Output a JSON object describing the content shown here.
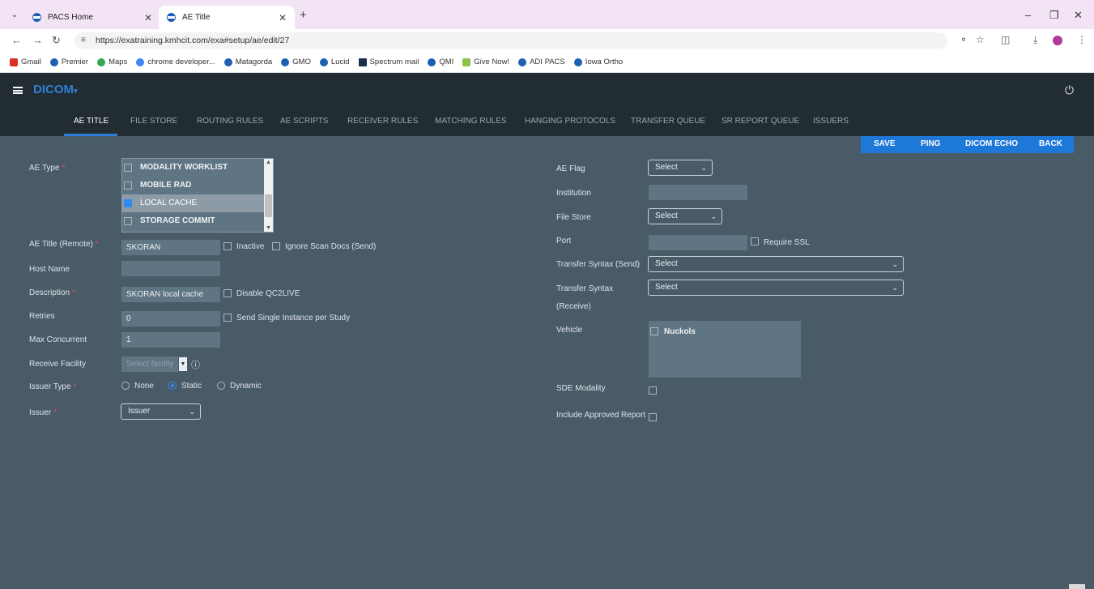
{
  "browser": {
    "tabs": [
      {
        "title": "PACS Home"
      },
      {
        "title": "AE Title"
      }
    ],
    "url": "https://exatraining.kmhcit.com/exa#setup/ae/edit/27",
    "bookmarks": [
      "Gmail",
      "Premier",
      "Maps",
      "chrome developer...",
      "Matagorda",
      "GMO",
      "Lucid",
      "Spectrum mail",
      "QMI",
      "Give Now!",
      "ADI PACS",
      "Iowa Ortho"
    ]
  },
  "app": {
    "title": "DICOM",
    "tabs": [
      "AE TITLE",
      "FILE STORE",
      "ROUTING RULES",
      "AE SCRIPTS",
      "RECEIVER RULES",
      "MATCHING RULES",
      "HANGING PROTOCOLS",
      "TRANSFER QUEUE",
      "SR REPORT QUEUE",
      "ISSUERS"
    ],
    "active_tab": "AE TITLE"
  },
  "actions": {
    "save": "SAVE",
    "ping": "PING",
    "dicom_echo": "DICOM ECHO",
    "back": "BACK"
  },
  "form_left": {
    "ae_type": {
      "label": "AE Type",
      "options": [
        "MODALITY WORKLIST",
        "MOBILE RAD",
        "LOCAL CACHE",
        "STORAGE COMMIT"
      ],
      "selected": "LOCAL CACHE"
    },
    "ae_title": {
      "label": "AE Title (Remote)",
      "value": "SKORAN"
    },
    "inactive": {
      "label": "Inactive",
      "checked": false
    },
    "ignore_scan_docs": {
      "label": "Ignore Scan Docs (Send)",
      "checked": false
    },
    "host_name": {
      "label": "Host Name",
      "value": ""
    },
    "description": {
      "label": "Description",
      "value": "SKORAN local cache"
    },
    "disable_qc2live": {
      "label": "Disable QC2LIVE",
      "checked": false
    },
    "retries": {
      "label": "Retries",
      "value": "0"
    },
    "send_single_instance": {
      "label": "Send Single Instance per Study",
      "checked": false
    },
    "max_concurrent": {
      "label": "Max Concurrent",
      "value": "1"
    },
    "receive_facility": {
      "label": "Receive Facility",
      "placeholder": "Select facility"
    },
    "issuer_type": {
      "label": "Issuer Type",
      "options": [
        "None",
        "Static",
        "Dynamic"
      ],
      "selected": "Static"
    },
    "issuer": {
      "label": "Issuer",
      "value": "Issuer"
    }
  },
  "form_right": {
    "ae_flag": {
      "label": "AE Flag",
      "value": "Select"
    },
    "institution": {
      "label": "Institution",
      "value": ""
    },
    "file_store": {
      "label": "File Store",
      "value": "Select"
    },
    "port": {
      "label": "Port",
      "value": ""
    },
    "require_ssl": {
      "label": "Require SSL",
      "checked": false
    },
    "transfer_syntax_send": {
      "label": "Transfer Syntax (Send)",
      "value": "Select"
    },
    "transfer_syntax_receive": {
      "label_line1": "Transfer Syntax",
      "label_line2": "(Receive)",
      "value": "Select"
    },
    "vehicle": {
      "label": "Vehicle",
      "options": [
        "Nuckols"
      ]
    },
    "sde_modality": {
      "label": "SDE Modality",
      "checked": false
    },
    "include_approved_report": {
      "label": "Include Approved Report",
      "checked": false
    }
  },
  "colors": {
    "accent": "#1e78d8",
    "header_bg": "#222c33",
    "content_bg": "#4a5b68",
    "field_bg": "#607584",
    "required": "#d9534f"
  }
}
